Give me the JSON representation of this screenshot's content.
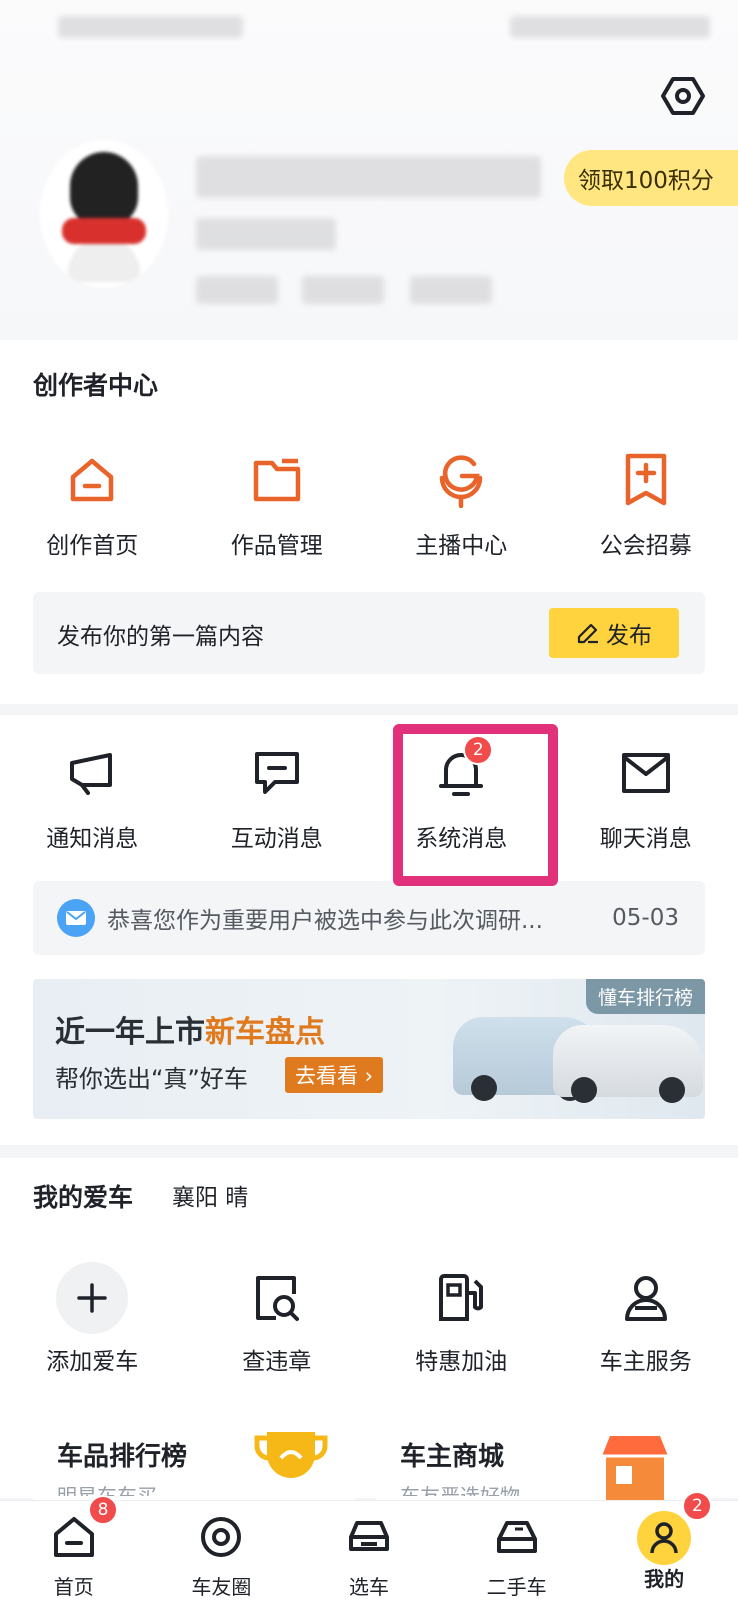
{
  "header": {
    "points_button": "领取100积分"
  },
  "creator": {
    "title": "创作者中心",
    "items": [
      {
        "label": "创作首页",
        "icon": "creator-home-icon"
      },
      {
        "label": "作品管理",
        "icon": "folder-icon"
      },
      {
        "label": "主播中心",
        "icon": "microphone-icon"
      },
      {
        "label": "公会招募",
        "icon": "bookmark-plus-icon"
      }
    ],
    "publish_prompt": "发布你的第一篇内容",
    "publish_button": "发布"
  },
  "messages": {
    "items": [
      {
        "label": "通知消息",
        "icon": "megaphone-icon"
      },
      {
        "label": "互动消息",
        "icon": "chat-bubble-icon"
      },
      {
        "label": "系统消息",
        "icon": "bell-icon",
        "badge": "2"
      },
      {
        "label": "聊天消息",
        "icon": "envelope-icon"
      }
    ],
    "notice_text": "恭喜您作为重要用户被选中参与此次调研...",
    "notice_date": "05-03"
  },
  "banner": {
    "tag": "懂车排行榜",
    "line1_a": "近一年上市",
    "line1_b": "新车盘点",
    "line2": "帮你选出“真”好车",
    "cta": "去看看 ›"
  },
  "my_car": {
    "title": "我的爱车",
    "city": "襄阳  晴",
    "items": [
      {
        "label": "添加爱车",
        "icon": "plus-icon"
      },
      {
        "label": "查违章",
        "icon": "search-doc-icon"
      },
      {
        "label": "特惠加油",
        "icon": "fuel-pump-icon"
      },
      {
        "label": "车主服务",
        "icon": "user-service-icon"
      }
    ]
  },
  "promo_cards": [
    {
      "title": "车品排行榜",
      "subtitle": "明星车车买"
    },
    {
      "title": "车主商城",
      "subtitle": "车友严选好物"
    }
  ],
  "tabbar": [
    {
      "label": "首页",
      "icon": "home-icon",
      "badge": "8"
    },
    {
      "label": "车友圈",
      "icon": "circle-icon"
    },
    {
      "label": "选车",
      "icon": "car-icon"
    },
    {
      "label": "二手车",
      "icon": "used-car-icon"
    },
    {
      "label": "我的",
      "icon": "profile-icon",
      "badge": "2",
      "active": true
    }
  ],
  "colors": {
    "accent_orange": "#e8642a",
    "accent_yellow": "#ffd33d",
    "highlight": "#e0317a",
    "badge_red": "#f24b4b"
  }
}
